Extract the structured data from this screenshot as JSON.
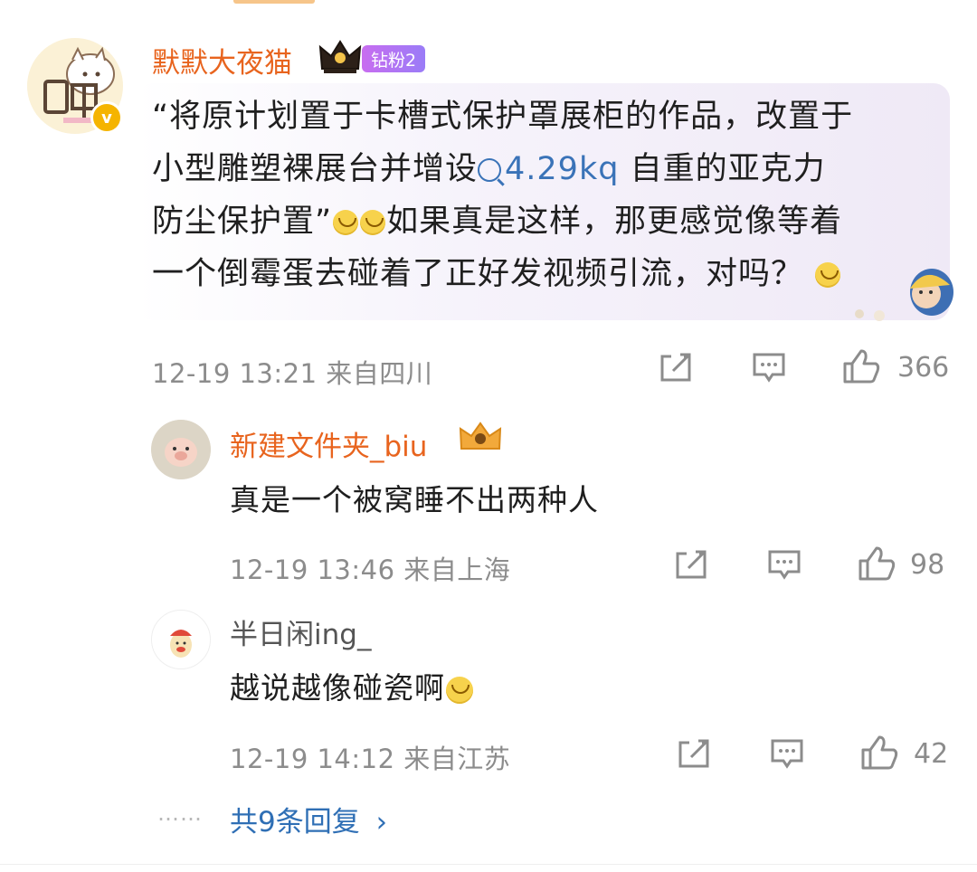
{
  "comment": {
    "author": "默默大夜猫",
    "badge": "钻粉2",
    "text_lines": [
      "“将原计划置于卡槽式保护罩展柜的作品，改置于",
      "小型雕塑裸展台并增设",
      "自重的亚克力",
      "防尘保护置”",
      "如果真是这样，那更感觉像等着",
      "一个倒霉蛋去碰着了正好发视频引流，对吗？"
    ],
    "link_text": "4.29kq",
    "time": "12-19 13:21",
    "location": "来自四川",
    "likes": "366"
  },
  "replies": [
    {
      "author": "新建文件夹_biu",
      "text": "真是一个被窝睡不出两种人",
      "time": "12-19 13:46",
      "location": "来自上海",
      "likes": "98"
    },
    {
      "author": "半日闲ing_",
      "text": "越说越像碰瓷啊",
      "time": "12-19 14:12",
      "location": "来自江苏",
      "likes": "42"
    }
  ],
  "more_replies": "共9条回复",
  "more_dots": "……",
  "colors": {
    "author": "#e8641e",
    "link": "#3a73b8",
    "meta": "#8c8c8c",
    "badge": "#b074f3"
  },
  "icons": [
    "crown-icon",
    "verified-icon",
    "share-icon",
    "comment-icon",
    "like-icon",
    "search-link-icon",
    "emoji-icon",
    "chevron-right-icon"
  ]
}
